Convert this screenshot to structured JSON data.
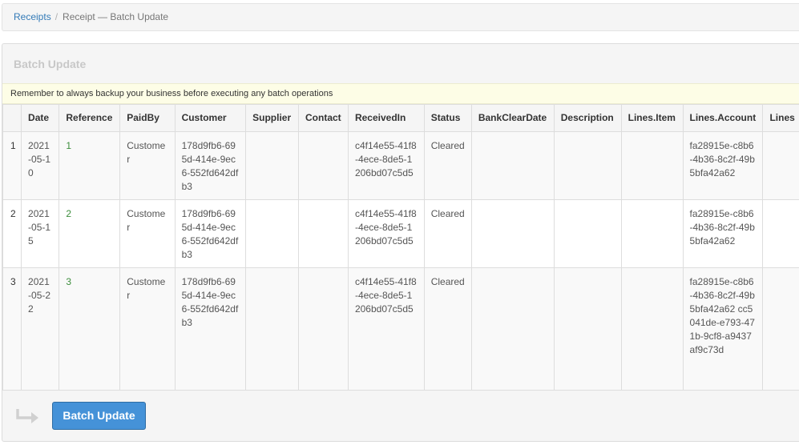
{
  "breadcrumb": {
    "root": "Receipts",
    "separator": "/",
    "current": "Receipt — Batch Update"
  },
  "panel": {
    "title": "Batch Update",
    "warning": "Remember to always backup your business before executing any batch operations"
  },
  "table": {
    "columns": [
      "",
      "Date",
      "Reference",
      "PaidBy",
      "Customer",
      "Supplier",
      "Contact",
      "ReceivedIn",
      "Status",
      "BankClearDate",
      "Description",
      "Lines.Item",
      "Lines.Account",
      "Lines"
    ],
    "rows": [
      {
        "num": "1",
        "date": "2021-05-10",
        "reference": "1",
        "paid_by": "Customer",
        "customer": "178d9fb6-695d-414e-9ec6-552fd642dfb3",
        "supplier": "",
        "contact": "",
        "received_in": "c4f14e55-41f8-4ece-8de5-1206bd07c5d5",
        "status": "Cleared",
        "bank_clear_date": "",
        "description": "",
        "lines_item": "",
        "lines_account": "fa28915e-c8b6-4b36-8c2f-49b5bfa42a62",
        "lines": ""
      },
      {
        "num": "2",
        "date": "2021-05-15",
        "reference": "2",
        "paid_by": "Customer",
        "customer": "178d9fb6-695d-414e-9ec6-552fd642dfb3",
        "supplier": "",
        "contact": "",
        "received_in": "c4f14e55-41f8-4ece-8de5-1206bd07c5d5",
        "status": "Cleared",
        "bank_clear_date": "",
        "description": "",
        "lines_item": "",
        "lines_account": "fa28915e-c8b6-4b36-8c2f-49b5bfa42a62",
        "lines": ""
      },
      {
        "num": "3",
        "date": "2021-05-22",
        "reference": "3",
        "paid_by": "Customer",
        "customer": "178d9fb6-695d-414e-9ec6-552fd642dfb3",
        "supplier": "",
        "contact": "",
        "received_in": "c4f14e55-41f8-4ece-8de5-1206bd07c5d5",
        "status": "Cleared",
        "bank_clear_date": "",
        "description": "",
        "lines_item": "",
        "lines_account": "fa28915e-c8b6-4b36-8c2f-49b5bfa42a62 cc5041de-e793-471b-9cf8-a9437af9c73d",
        "lines": ""
      }
    ]
  },
  "footer": {
    "arrow_icon": "return-arrow-icon",
    "button_label": "Batch Update"
  },
  "colors": {
    "primary_button": "#4592d8",
    "link": "#337ab7",
    "reference_text": "#3c8d3c",
    "warning_bg": "#fdfde6"
  }
}
